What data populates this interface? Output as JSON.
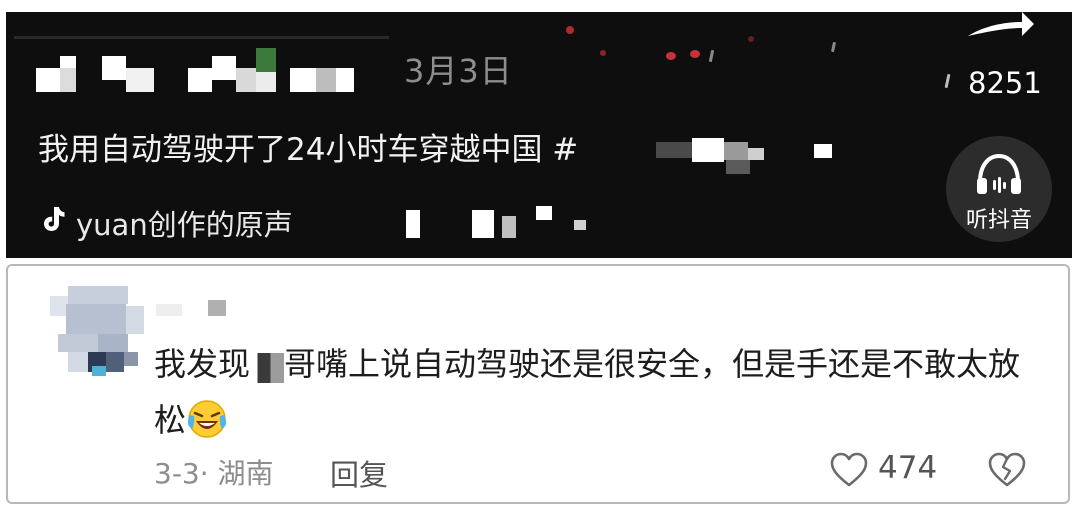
{
  "video": {
    "date": "3月3日",
    "title": "我用自动驾驶开了24小时车穿越中国 #",
    "music_text": "yuan创作的原声",
    "share_count": "8251",
    "listen_label": "听抖音",
    "icons": {
      "music": "tiktok-note-icon",
      "share": "share-arrow-icon",
      "listen": "headphone-icon"
    }
  },
  "comment": {
    "text_before": "我发现",
    "text_after": "哥嘴上说自动驾驶还是很安全，但是手还是不敢太放松",
    "emoji": "laughing-crying-emoji",
    "meta": "3-3· 湖南",
    "reply_label": "回复",
    "like_count": "474",
    "icons": {
      "like": "heart-outline-icon",
      "dislike": "broken-heart-icon"
    }
  }
}
